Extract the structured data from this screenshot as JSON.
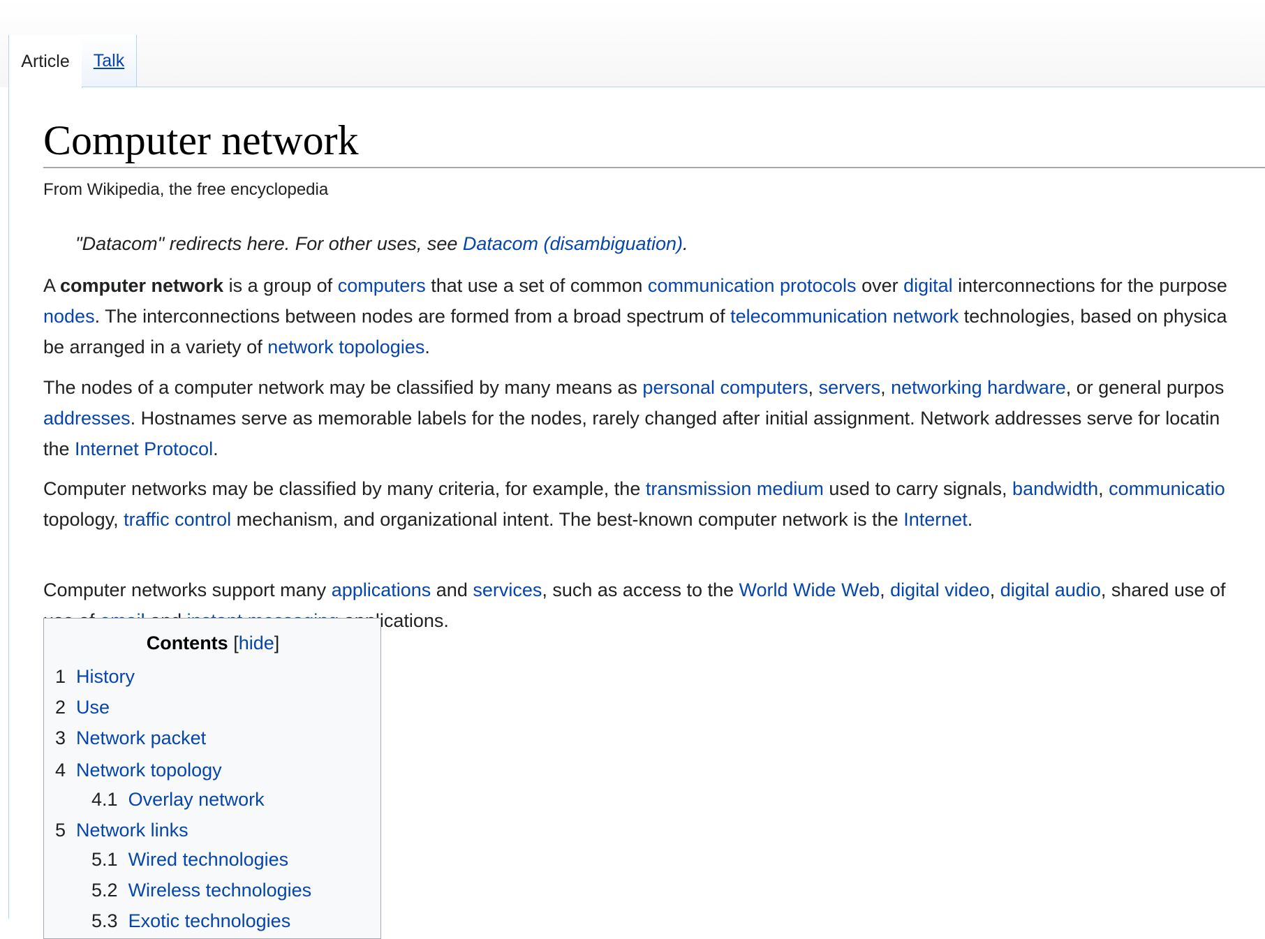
{
  "tabs": {
    "article": "Article",
    "talk": "Talk"
  },
  "page": {
    "title": "Computer network",
    "tagline": "From Wikipedia, the free encyclopedia",
    "hatnote": {
      "prefix": "\"Datacom\" redirects here. For other uses, see ",
      "link": "Datacom (disambiguation)",
      "suffix": "."
    }
  },
  "p1": {
    "t0": "A ",
    "bold": "computer network",
    "t1": " is a group of ",
    "l1": "computers",
    "t2": " that use a set of common ",
    "l2": "communication protocols",
    "t3": " over ",
    "l3": "digital",
    "t4": " interconnections for the purpose",
    "l4": "nodes",
    "t5": ". The interconnections between nodes are formed from a broad spectrum of ",
    "l5": "telecommunication network",
    "t6": " technologies, based on physica",
    "t7": "be arranged in a variety of ",
    "l6": "network topologies",
    "t8": "."
  },
  "p2": {
    "t0": "The nodes of a computer network may be classified by many means as ",
    "l1": "personal computers",
    "t1": ", ",
    "l2": "servers",
    "t2": ", ",
    "l3": "networking hardware",
    "t3": ", or general purpos",
    "l4": "addresses",
    "t4": ". Hostnames serve as memorable labels for the nodes, rarely changed after initial assignment. Network addresses serve for locatin",
    "t5": "the ",
    "l5": "Internet Protocol",
    "t6": "."
  },
  "p3": {
    "t0": "Computer networks may be classified by many criteria, for example, the ",
    "l1": "transmission medium",
    "t1": " used to carry signals, ",
    "l2": "bandwidth",
    "t2": ", ",
    "l3": "communicatio",
    "t3": "topology, ",
    "l4": "traffic control",
    "t4": " mechanism, and organizational intent. The best-known computer network is the ",
    "l5": "Internet",
    "t5": "."
  },
  "p4": {
    "t0": "Computer networks support many ",
    "l1": "applications",
    "t1": " and ",
    "l2": "services",
    "t2": ", such as access to the ",
    "l3": "World Wide Web",
    "t3": ", ",
    "l4": "digital video",
    "t4": ", ",
    "l5": "digital audio",
    "t5": ", shared use of",
    "t6": "use of ",
    "l6": "email",
    "t7": " and ",
    "l7": "instant messaging",
    "t8": " applications."
  },
  "toc": {
    "title": "Contents",
    "bracket_open": "[",
    "hide": "hide",
    "bracket_close": "]",
    "items": [
      {
        "num": "1",
        "label": "History"
      },
      {
        "num": "2",
        "label": "Use"
      },
      {
        "num": "3",
        "label": "Network packet"
      },
      {
        "num": "4",
        "label": "Network topology"
      },
      {
        "num": "4.1",
        "label": "Overlay network"
      },
      {
        "num": "5",
        "label": "Network links"
      },
      {
        "num": "5.1",
        "label": "Wired technologies"
      },
      {
        "num": "5.2",
        "label": "Wireless technologies"
      },
      {
        "num": "5.3",
        "label": "Exotic technologies"
      }
    ]
  },
  "colors": {
    "link": "#0645ad",
    "text": "#202122",
    "border": "#a7d7f9",
    "toc_bg": "#f8f9fa"
  }
}
